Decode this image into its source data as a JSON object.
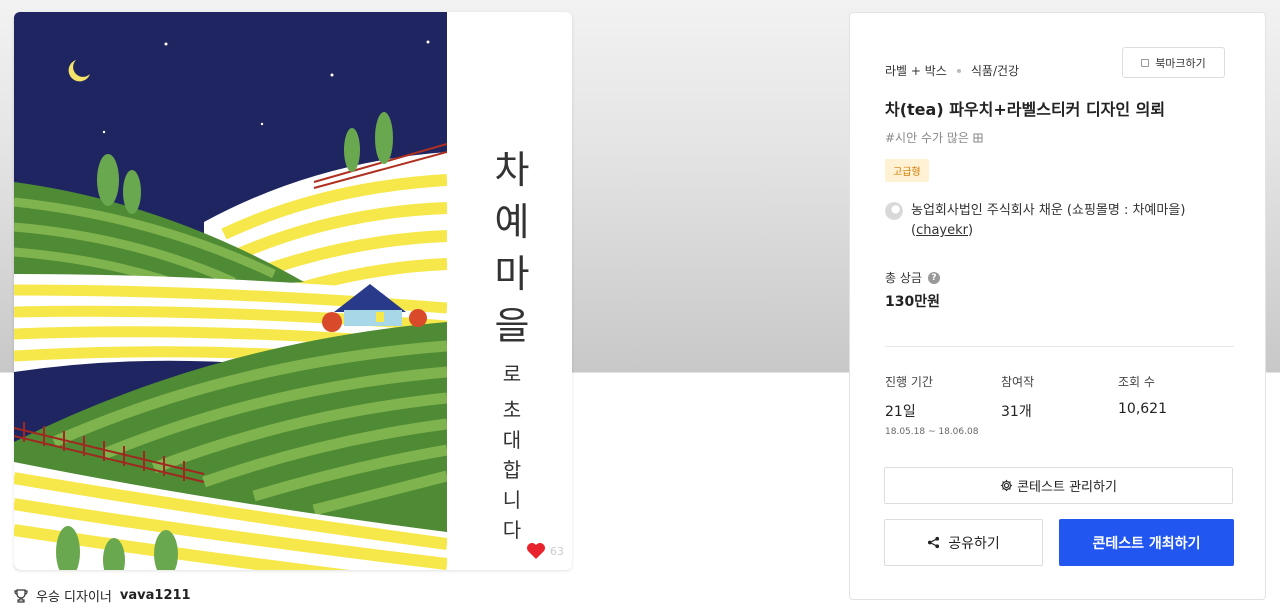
{
  "artwork": {
    "title_big": [
      "차",
      "예",
      "마",
      "을"
    ],
    "title_small": [
      "로",
      "초",
      "대",
      "합",
      "니",
      "다"
    ],
    "like_count": "63"
  },
  "winner": {
    "label": "우승 디자이너",
    "name": "vava1211"
  },
  "panel": {
    "category": "라벨 + 박스",
    "subcategory": "식품/건강",
    "bookmark_label": "북마크하기",
    "title": "차(tea) 파우치+라벨스티커 디자인 의뢰",
    "tag": "#시안 수가 많은 ",
    "grade": "고급형",
    "host_name": "농업회사법인 주식회사 채운 (쇼핑몰명 : 차예마을) (",
    "host_id": "chayekr",
    "host_close": ")",
    "prize_label": "총 상금",
    "prize_value": "130만원",
    "period_label": "진행 기간",
    "period_value": "21일",
    "period_dates": "18.05.18 ~ 18.06.08",
    "entries_label": "참여작",
    "entries_value": "31개",
    "views_label": "조회 수",
    "views_value": "10,621",
    "manage_label": "콘테스트 관리하기",
    "share_label": "공유하기",
    "host_contest_label": "콘테스트 개최하기"
  },
  "colors": {
    "primary": "#2156f0",
    "badge_bg": "#fff2d4",
    "badge_text": "#d47a00",
    "sky": "#1f2560",
    "field_green": "#5c9a3e",
    "field_yellow": "#f6e84a"
  },
  "icons": [
    "trophy-icon",
    "heart-icon",
    "bookmark-icon",
    "help-icon",
    "gear-icon",
    "share-icon",
    "host-avatar-icon"
  ]
}
